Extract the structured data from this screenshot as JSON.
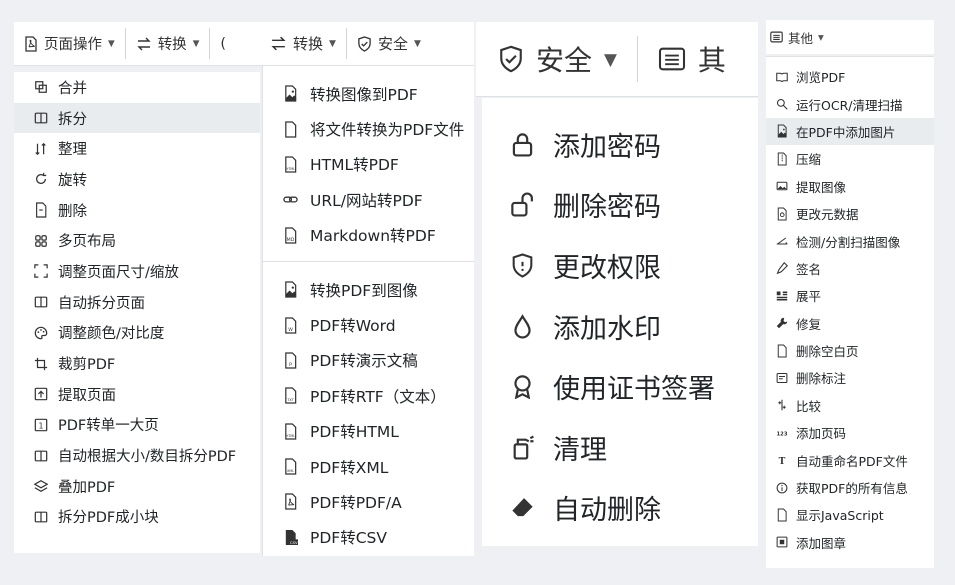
{
  "panel1": {
    "toolbar": {
      "page_ops_label": "页面操作",
      "convert_label": "转换",
      "overflow_glyph": "("
    },
    "items": [
      {
        "label": "合并",
        "icon": "merge-icon"
      },
      {
        "label": "拆分",
        "icon": "split-icon"
      },
      {
        "label": "整理",
        "icon": "sort-icon"
      },
      {
        "label": "旋转",
        "icon": "rotate-icon"
      },
      {
        "label": "删除",
        "icon": "delete-icon"
      },
      {
        "label": "多页布局",
        "icon": "grid-icon"
      },
      {
        "label": "调整页面尺寸/缩放",
        "icon": "resize-icon"
      },
      {
        "label": "自动拆分页面",
        "icon": "split-icon"
      },
      {
        "label": "调整颜色/对比度",
        "icon": "palette-icon"
      },
      {
        "label": "裁剪PDF",
        "icon": "crop-icon"
      },
      {
        "label": "提取页面",
        "icon": "extract-icon"
      },
      {
        "label": "PDF转单一大页",
        "icon": "single-page-icon"
      },
      {
        "label": "自动根据大小/数目拆分PDF",
        "icon": "split-icon"
      },
      {
        "label": "叠加PDF",
        "icon": "layers-icon"
      },
      {
        "label": "拆分PDF成小块",
        "icon": "split-icon"
      }
    ],
    "active_index": 1
  },
  "panel2": {
    "toolbar": {
      "convert_label": "转换",
      "security_label": "安全"
    },
    "group1": [
      {
        "label": "转换图像到PDF",
        "icon": "image-file-icon"
      },
      {
        "label": "将文件转换为PDF文件",
        "icon": "file-icon"
      },
      {
        "label": "HTML转PDF",
        "icon": "html-file-icon",
        "tag": "HTML"
      },
      {
        "label": "URL/网站转PDF",
        "icon": "link-icon"
      },
      {
        "label": "Markdown转PDF",
        "icon": "md-file-icon",
        "tag": "MD"
      }
    ],
    "group2": [
      {
        "label": "转换PDF到图像",
        "icon": "image-file-icon"
      },
      {
        "label": "PDF转Word",
        "icon": "word-file-icon",
        "tag": "W"
      },
      {
        "label": "PDF转演示文稿",
        "icon": "ppt-file-icon",
        "tag": "P"
      },
      {
        "label": "PDF转RTF（文本）",
        "icon": "txt-file-icon",
        "tag": "TXT"
      },
      {
        "label": "PDF转HTML",
        "icon": "html-file-icon",
        "tag": "HTML"
      },
      {
        "label": "PDF转XML",
        "icon": "xml-file-icon",
        "tag": "XML"
      },
      {
        "label": "PDF转PDF/A",
        "icon": "pdfa-file-icon"
      },
      {
        "label": "PDF转CSV",
        "icon": "csv-file-icon",
        "tag": "CSV"
      }
    ]
  },
  "panel3": {
    "toolbar": {
      "security_label": "安全",
      "other_label_partial": "其"
    },
    "items": [
      {
        "label": "添加密码",
        "icon": "lock-icon"
      },
      {
        "label": "删除密码",
        "icon": "unlock-icon"
      },
      {
        "label": "更改权限",
        "icon": "shield-icon"
      },
      {
        "label": "添加水印",
        "icon": "droplet-icon"
      },
      {
        "label": "使用证书签署",
        "icon": "award-icon"
      },
      {
        "label": "清理",
        "icon": "sanitize-icon"
      },
      {
        "label": "自动删除",
        "icon": "eraser-icon"
      }
    ]
  },
  "panel4": {
    "toolbar": {
      "other_label": "其他"
    },
    "items": [
      {
        "label": "浏览PDF",
        "icon": "book-icon"
      },
      {
        "label": "运行OCR/清理扫描",
        "icon": "search-icon"
      },
      {
        "label": "在PDF中添加图片",
        "icon": "image-file-icon"
      },
      {
        "label": "压缩",
        "icon": "compress-icon"
      },
      {
        "label": "提取图像",
        "icon": "images-icon"
      },
      {
        "label": "更改元数据",
        "icon": "metadata-icon"
      },
      {
        "label": "检测/分割扫描图像",
        "icon": "scan-icon"
      },
      {
        "label": "签名",
        "icon": "pen-icon"
      },
      {
        "label": "展平",
        "icon": "flatten-icon"
      },
      {
        "label": "修复",
        "icon": "wrench-icon"
      },
      {
        "label": "删除空白页",
        "icon": "blank-page-icon"
      },
      {
        "label": "删除标注",
        "icon": "annotation-icon"
      },
      {
        "label": "比较",
        "icon": "compare-icon"
      },
      {
        "label": "添加页码",
        "icon": "numbers-icon",
        "tag": "123"
      },
      {
        "label": "自动重命名PDF文件",
        "icon": "text-icon",
        "tag": "T"
      },
      {
        "label": "获取PDF的所有信息",
        "icon": "info-icon"
      },
      {
        "label": "显示JavaScript",
        "icon": "js-file-icon"
      },
      {
        "label": "添加图章",
        "icon": "stamp-icon"
      }
    ],
    "active_index": 2
  },
  "colors": {
    "background": "#eef0f3",
    "panel": "#ffffff",
    "active_row": "#e9ecef",
    "text": "#212529"
  }
}
